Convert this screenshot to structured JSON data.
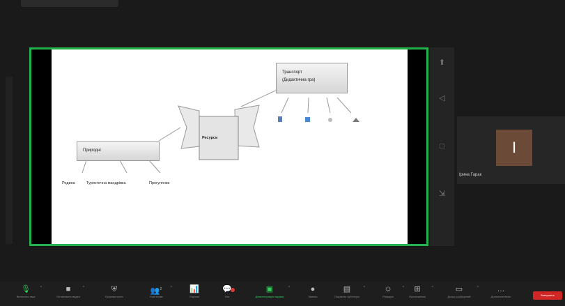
{
  "slide": {
    "center_label": "Ресурси",
    "left_box": "Природні",
    "left_items": [
      "Родина",
      "Туристична мандрівка",
      "Прогулянки"
    ],
    "right_box_line1": "Транспорт",
    "right_box_line2": "(Дидактична гра)"
  },
  "participant": {
    "name": "Ірина Гарак",
    "avatar_letter": "І"
  },
  "toolbar": {
    "items": [
      {
        "label": "Включить звук",
        "icon": "mic-icon"
      },
      {
        "label": "Остановить видео",
        "icon": "camera-icon"
      },
      {
        "label": "Безопасность",
        "icon": "shield-icon"
      },
      {
        "label": "Участники",
        "icon": "participants-icon"
      },
      {
        "label": "Опросы",
        "icon": "polls-icon"
      },
      {
        "label": "Чат",
        "icon": "chat-icon"
      },
      {
        "label": "Демонстрация экрана",
        "icon": "share-screen-icon"
      },
      {
        "label": "Запись",
        "icon": "record-icon"
      },
      {
        "label": "Показать субтитры",
        "icon": "captions-icon"
      },
      {
        "label": "Реакции",
        "icon": "reactions-icon"
      },
      {
        "label": "Приложения",
        "icon": "apps-icon"
      },
      {
        "label": "Доска сообщений",
        "icon": "whiteboard-icon"
      },
      {
        "label": "Дополнительно",
        "icon": "more-icon"
      }
    ],
    "participants_count": "2",
    "end_label": "Завершить",
    "accent_color": "#22b14c",
    "end_color": "#d02626"
  }
}
